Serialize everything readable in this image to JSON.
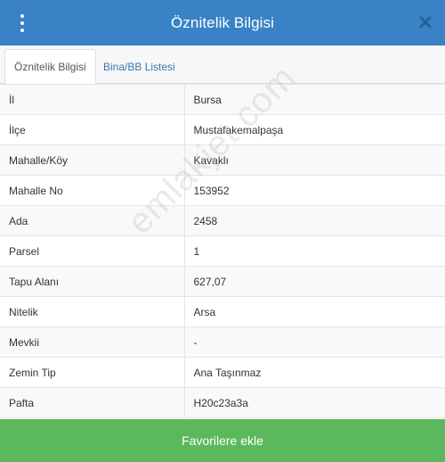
{
  "header": {
    "title": "Öznitelik Bilgisi",
    "menu_icon": "vertical-dots-icon",
    "close_icon": "close-icon"
  },
  "tabs": [
    {
      "label": "Öznitelik Bilgisi",
      "active": true
    },
    {
      "label": "Bina/BB Listesi",
      "active": false
    }
  ],
  "rows": [
    {
      "key": "İl",
      "value": "Bursa"
    },
    {
      "key": "İlçe",
      "value": "Mustafakemalpaşa"
    },
    {
      "key": "Mahalle/Köy",
      "value": "Kavaklı"
    },
    {
      "key": "Mahalle No",
      "value": "153952"
    },
    {
      "key": "Ada",
      "value": "2458"
    },
    {
      "key": "Parsel",
      "value": "1"
    },
    {
      "key": "Tapu Alanı",
      "value": "627,07"
    },
    {
      "key": "Nitelik",
      "value": "Arsa"
    },
    {
      "key": "Mevkii",
      "value": "-"
    },
    {
      "key": "Zemin Tip",
      "value": "Ana Taşınmaz"
    },
    {
      "key": "Pafta",
      "value": "H20c23a3a"
    }
  ],
  "watermark": "emlakjet.com",
  "footer": {
    "button_label": "Favorilere ekle"
  },
  "colors": {
    "header_bg": "#3a82c6",
    "tab_link": "#337ab7",
    "button_bg": "#5cb85c"
  }
}
